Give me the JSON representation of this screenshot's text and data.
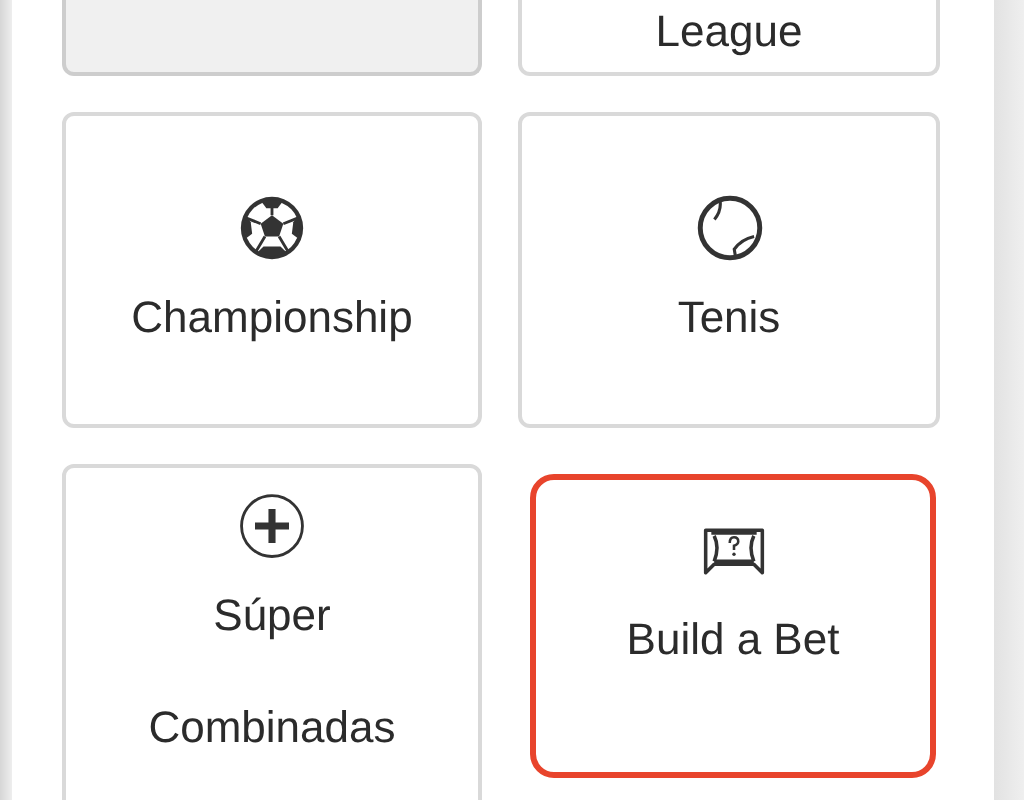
{
  "tiles": [
    {
      "kind": "plain",
      "selected": false,
      "disabled": true
    },
    {
      "label": "League",
      "kind": "plain",
      "selected": false,
      "disabled": false
    },
    {
      "label": "Championship",
      "kind": "soccer",
      "selected": false,
      "disabled": false
    },
    {
      "label": "Tenis",
      "kind": "tennis",
      "selected": false,
      "disabled": false
    },
    {
      "label": "Súper Combinadas",
      "kind": "combo",
      "selected": false,
      "disabled": false
    },
    {
      "label": "Build a Bet",
      "kind": "goal",
      "selected": true,
      "disabled": false
    }
  ]
}
